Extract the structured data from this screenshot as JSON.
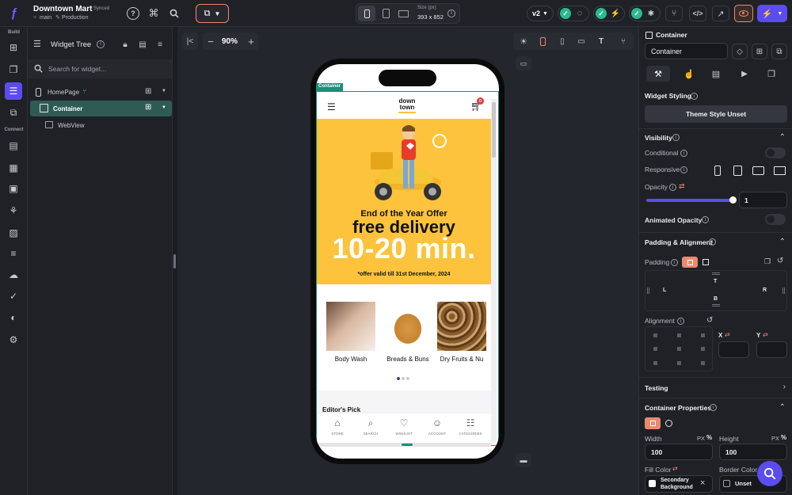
{
  "header": {
    "project_name": "Downtown Mart",
    "sync_status": "Synced",
    "branch": "main",
    "environment": "Production",
    "device_size_label": "Size (px)",
    "device_size_value": "393 x 852",
    "version": "v2"
  },
  "rail": {
    "build_label": "Build",
    "connect_label": "Connect"
  },
  "widget_tree": {
    "title": "Widget Tree",
    "search_placeholder": "Search for widget...",
    "nodes": [
      {
        "label": "HomePage"
      },
      {
        "label": "Container"
      },
      {
        "label": "WebView"
      }
    ]
  },
  "canvas": {
    "zoom": "90%",
    "selected_badge": "Container"
  },
  "app_preview": {
    "logo_line1": "down",
    "logo_line2": "town",
    "cart_count": "0",
    "banner": {
      "line1": "End of the Year Offer",
      "line2": "free delivery",
      "line3": "10-20 min.",
      "line4": "*offer valid till 31st December, 2024",
      "background": "#fdc33c"
    },
    "categories": [
      {
        "label": "Body Wash"
      },
      {
        "label": "Breads & Buns"
      },
      {
        "label": "Dry Fruits & Nu"
      }
    ],
    "section_title": "Editor's Pick",
    "bottom_nav": [
      {
        "label": "STORE",
        "icon": "store-icon"
      },
      {
        "label": "SEARCH",
        "icon": "search-icon"
      },
      {
        "label": "WISHLIST",
        "icon": "heart-icon"
      },
      {
        "label": "ACCOUNT",
        "icon": "user-icon"
      },
      {
        "label": "CATEGORIES",
        "icon": "grid-icon"
      }
    ]
  },
  "properties": {
    "widget_type": "Container",
    "widget_name": "Container",
    "widget_styling_label": "Widget Styling",
    "theme_style_button": "Theme Style Unset",
    "visibility": {
      "title": "Visibility",
      "conditional": "Conditional",
      "responsive": "Responsive",
      "opacity": "Opacity",
      "opacity_value": "1",
      "opacity_fraction": 1,
      "animated_opacity": "Animated Opacity"
    },
    "padding_alignment": {
      "title": "Padding & Alignment",
      "padding": "Padding",
      "t": "T",
      "b": "B",
      "l": "L",
      "r": "R",
      "alignment": "Alignment",
      "x": "X",
      "y": "Y"
    },
    "testing": "Testing",
    "container_properties": {
      "title": "Container Properties",
      "width_label": "Width",
      "width_unit": "PX",
      "width_value": "100",
      "height_label": "Height",
      "height_unit": "PX",
      "height_value": "100",
      "fill_color_label": "Fill Color",
      "fill_color_value_line1": "Secondary",
      "fill_color_value_line2": "Background",
      "border_color_label": "Border Color",
      "border_color_value": "Unset"
    }
  },
  "colors": {
    "accent": "#5b4cf0",
    "selection": "#2f5b55",
    "highlight": "#e98a6e",
    "success": "#29b98f",
    "app_green": "#1a8f7a"
  }
}
